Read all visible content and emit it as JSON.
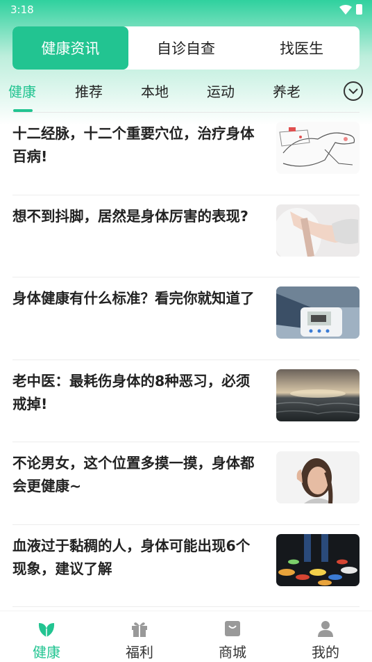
{
  "status_bar": {
    "time": "3:18"
  },
  "segment_tabs": [
    {
      "label": "健康资讯",
      "active": true
    },
    {
      "label": "自诊自查",
      "active": false
    },
    {
      "label": "找医生",
      "active": false
    }
  ],
  "category_tabs": [
    {
      "label": "健康",
      "active": true
    },
    {
      "label": "推荐",
      "active": false
    },
    {
      "label": "本地",
      "active": false
    },
    {
      "label": "运动",
      "active": false
    },
    {
      "label": "养老",
      "active": false
    }
  ],
  "news": [
    {
      "title": "十二经脉，十二个重要穴位，治疗身体百病!",
      "thumb": "acupuncture-hand-illustration"
    },
    {
      "title": "想不到抖脚，居然是身体厉害的表现?",
      "thumb": "legs-photo"
    },
    {
      "title": "身体健康有什么标准？看完你就知道了",
      "thumb": "blood-pressure-monitor-photo"
    },
    {
      "title": "老中医：最耗伤身体的8种恶习，必须戒掉!",
      "thumb": "sea-sunset-photo"
    },
    {
      "title": "不论男女，这个位置多摸一摸，身体都会更健康~",
      "thumb": "woman-listening-photo"
    },
    {
      "title": "血液过于黏稠的人，身体可能出现6个现象，建议了解",
      "thumb": "pills-photo"
    }
  ],
  "bottom_nav": [
    {
      "label": "健康",
      "icon": "leaf-icon",
      "active": true
    },
    {
      "label": "福利",
      "icon": "gift-icon",
      "active": false
    },
    {
      "label": "商城",
      "icon": "shop-bag-icon",
      "active": false
    },
    {
      "label": "我的",
      "icon": "user-icon",
      "active": false
    }
  ],
  "colors": {
    "accent": "#22c491",
    "header_top": "#2fd19e"
  }
}
